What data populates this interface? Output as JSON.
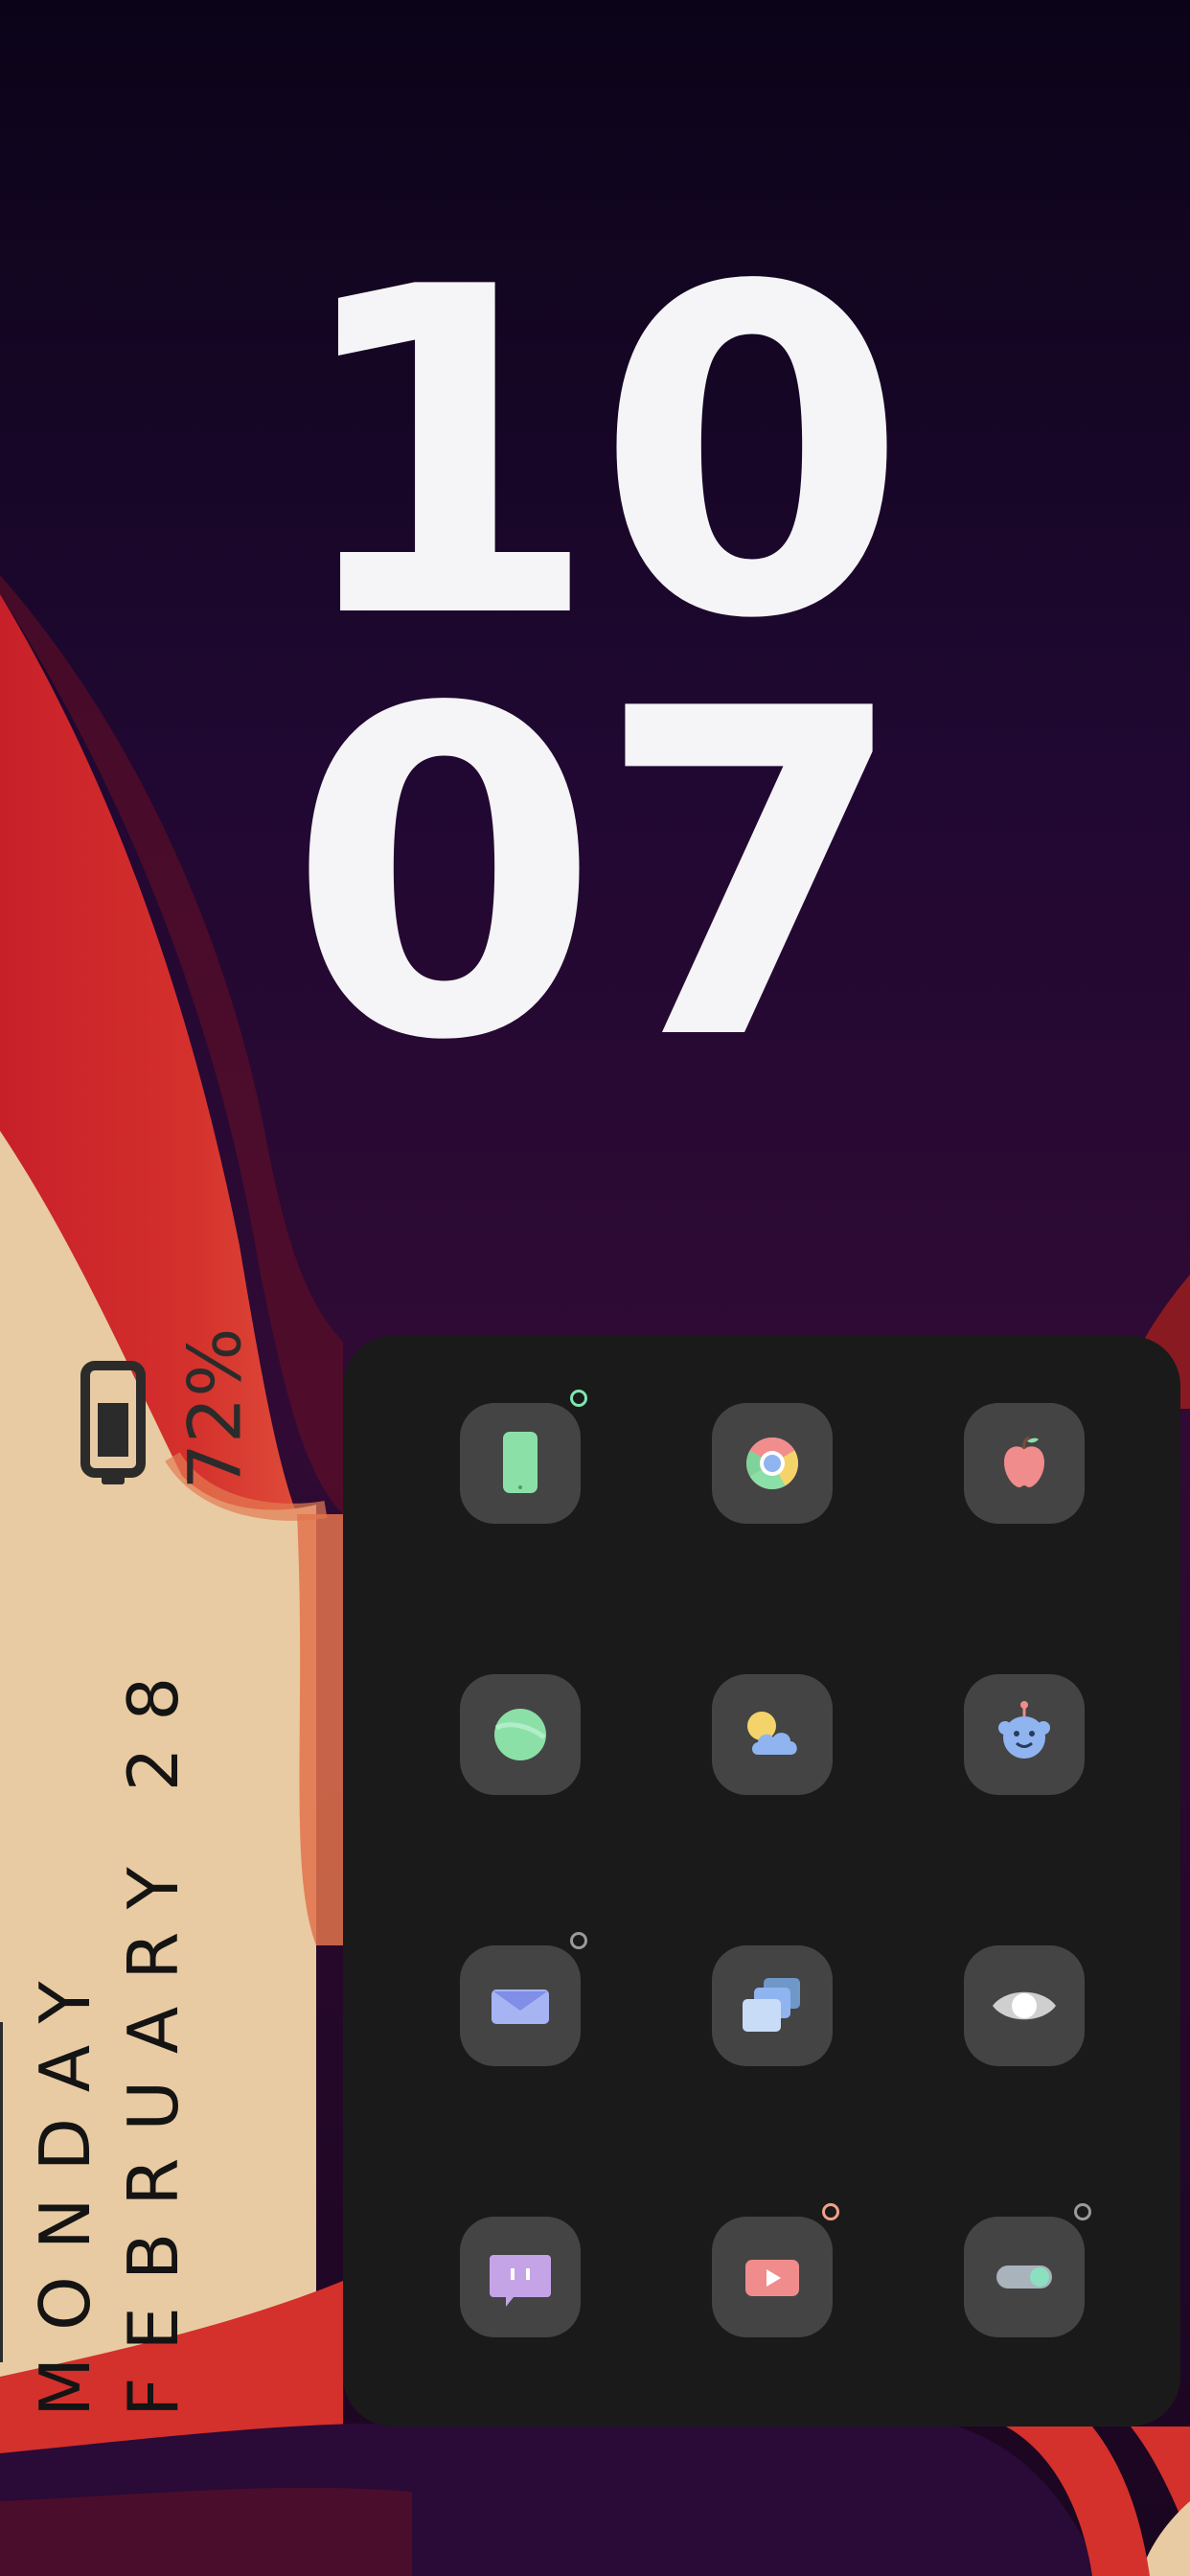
{
  "clock": {
    "hours": "10",
    "minutes": "07"
  },
  "battery": {
    "label": "72%",
    "level": 0.72
  },
  "date": {
    "day": "MONDAY",
    "date": "FEBRUARY 28"
  },
  "apps": [
    {
      "icon": "phone-icon",
      "badge": "#7ee6b0"
    },
    {
      "icon": "chrome-icon",
      "badge": null
    },
    {
      "icon": "apple-icon",
      "badge": null
    },
    {
      "icon": "green-orb-icon",
      "badge": null
    },
    {
      "icon": "weather-icon",
      "badge": null
    },
    {
      "icon": "robot-icon",
      "badge": null
    },
    {
      "icon": "mail-icon",
      "badge": "#9a9a9a"
    },
    {
      "icon": "gallery-icon",
      "badge": null
    },
    {
      "icon": "eye-icon",
      "badge": null
    },
    {
      "icon": "chat-icon",
      "badge": null
    },
    {
      "icon": "youtube-icon",
      "badge": "#f2a08a"
    },
    {
      "icon": "toggle-icon",
      "badge": "#9a9a9a"
    }
  ],
  "colors": {
    "clock_text": "#f5f4f6",
    "dock_background": "#1a1a1a",
    "app_tile": "#444444",
    "wallpaper_red": "#d4302c",
    "wallpaper_sand": "#e8cba2",
    "wallpaper_purple": "#1c0826"
  }
}
